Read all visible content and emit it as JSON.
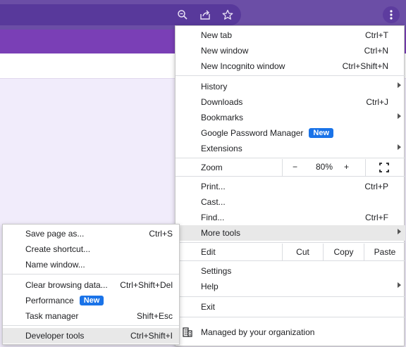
{
  "colors": {
    "toolbar": "#6b4ea6",
    "page_header": "#7a3fb6",
    "page_body": "#f1ecfb",
    "badge": "#1a73e8",
    "hover": "#e8e8e8"
  },
  "toolbar": {
    "icons": [
      "zoom-icon",
      "share-icon",
      "bookmark-star-icon",
      "kebab-menu-icon"
    ]
  },
  "menu": {
    "new_tab": {
      "label": "New tab",
      "shortcut": "Ctrl+T"
    },
    "new_window": {
      "label": "New window",
      "shortcut": "Ctrl+N"
    },
    "new_incognito": {
      "label": "New Incognito window",
      "shortcut": "Ctrl+Shift+N"
    },
    "history": {
      "label": "History"
    },
    "downloads": {
      "label": "Downloads",
      "shortcut": "Ctrl+J"
    },
    "bookmarks": {
      "label": "Bookmarks"
    },
    "password_manager": {
      "label": "Google Password Manager",
      "badge": "New"
    },
    "extensions": {
      "label": "Extensions"
    },
    "zoom": {
      "label": "Zoom",
      "minus": "−",
      "value": "80%",
      "plus": "+"
    },
    "print": {
      "label": "Print...",
      "shortcut": "Ctrl+P"
    },
    "cast": {
      "label": "Cast..."
    },
    "find": {
      "label": "Find...",
      "shortcut": "Ctrl+F"
    },
    "more_tools": {
      "label": "More tools"
    },
    "edit": {
      "label": "Edit",
      "cut": "Cut",
      "copy": "Copy",
      "paste": "Paste"
    },
    "settings": {
      "label": "Settings"
    },
    "help": {
      "label": "Help"
    },
    "exit": {
      "label": "Exit"
    },
    "managed": {
      "label": "Managed by your organization"
    }
  },
  "submenu": {
    "save_page": {
      "label": "Save page as...",
      "shortcut": "Ctrl+S"
    },
    "create_shortcut": {
      "label": "Create shortcut..."
    },
    "name_window": {
      "label": "Name window..."
    },
    "clear_browsing": {
      "label": "Clear browsing data...",
      "shortcut": "Ctrl+Shift+Del"
    },
    "performance": {
      "label": "Performance",
      "badge": "New"
    },
    "task_manager": {
      "label": "Task manager",
      "shortcut": "Shift+Esc"
    },
    "developer_tools": {
      "label": "Developer tools",
      "shortcut": "Ctrl+Shift+I"
    }
  }
}
